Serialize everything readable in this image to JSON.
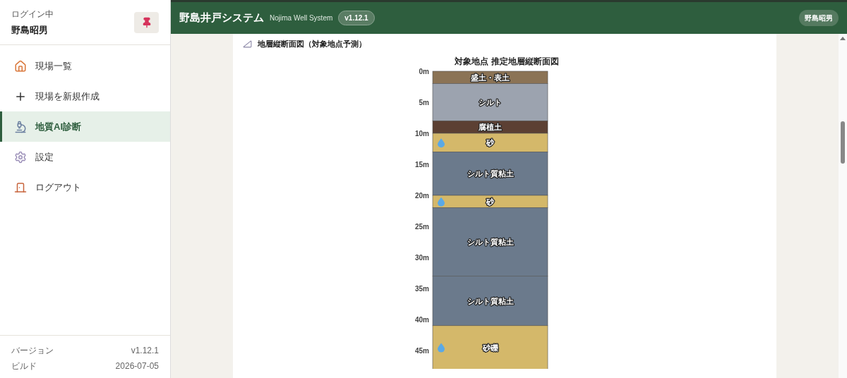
{
  "sidebar": {
    "login_label": "ログイン中",
    "user_name": "野島昭男",
    "items": [
      {
        "label": "現場一覧",
        "selected": false
      },
      {
        "label": "現場を新規作成",
        "selected": false
      },
      {
        "label": "地質AI診断",
        "selected": true
      },
      {
        "label": "設定",
        "selected": false
      },
      {
        "label": "ログアウト",
        "selected": false
      }
    ],
    "footer": [
      {
        "label": "バージョン",
        "value": "v1.12.1"
      },
      {
        "label": "ビルド",
        "value": "2026-07-05"
      }
    ]
  },
  "header": {
    "title": "野島井戸システム",
    "subtitle": "Nojima Well System",
    "version": "v1.12.1",
    "user": "野島昭男"
  },
  "section": {
    "title": "地層縦断面図（対象地点予測）",
    "layer_water": [
      {
        "water": false
      },
      {
        "water": false
      },
      {
        "water": false
      },
      {
        "water": true
      },
      {
        "water": false
      },
      {
        "water": true
      },
      {
        "water": false
      },
      {
        "water": false
      },
      {
        "water": true
      }
    ],
    "chart_data": {
      "type": "bar",
      "title": "対象地点 推定地層縦断面図",
      "stacked": true,
      "orientation": "vertical",
      "ylim": [
        48,
        0
      ],
      "yticks": [
        {
          "value": 0,
          "label": "0m"
        },
        {
          "value": 5,
          "label": "5m"
        },
        {
          "value": 10,
          "label": "10m"
        },
        {
          "value": 15,
          "label": "15m"
        },
        {
          "value": 20,
          "label": "20m"
        },
        {
          "value": 25,
          "label": "25m"
        },
        {
          "value": 30,
          "label": "30m"
        },
        {
          "value": 35,
          "label": "35m"
        },
        {
          "value": 40,
          "label": "40m"
        },
        {
          "value": 45,
          "label": "45m"
        }
      ],
      "series": [
        {
          "name": "盛土・表土",
          "color": "#8b7355",
          "values": [
            2
          ]
        },
        {
          "name": "シルト",
          "color": "#9ca3af",
          "values": [
            6
          ]
        },
        {
          "name": "腐植土",
          "color": "#5c4033",
          "values": [
            2
          ]
        },
        {
          "name": "砂",
          "color": "#d4b86a",
          "values": [
            3
          ]
        },
        {
          "name": "シルト質粘土",
          "color": "#6b7a8c",
          "values": [
            7
          ]
        },
        {
          "name": "砂",
          "color": "#d4b86a",
          "values": [
            2
          ]
        },
        {
          "name": "シルト質粘土",
          "color": "#6b7a8c",
          "values": [
            11
          ]
        },
        {
          "name": "シルト質粘土",
          "color": "#6b7a8c",
          "values": [
            8
          ]
        },
        {
          "name": "砂礫",
          "color": "#d4b86a",
          "values": [
            7
          ]
        }
      ]
    }
  }
}
